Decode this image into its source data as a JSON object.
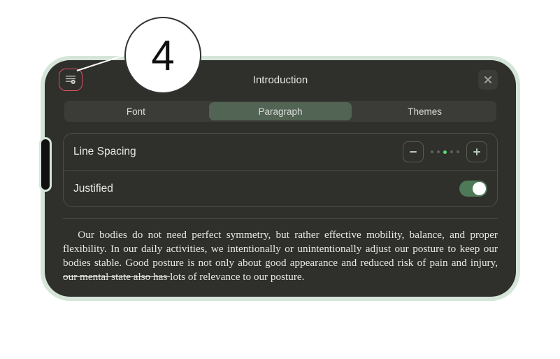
{
  "callout": {
    "number": "4"
  },
  "header": {
    "title": "Introduction"
  },
  "tabs": {
    "font": "Font",
    "paragraph": "Paragraph",
    "themes": "Themes",
    "selected": "paragraph"
  },
  "paragraph_settings": {
    "line_spacing_label": "Line Spacing",
    "line_spacing_level": 3,
    "line_spacing_max": 5,
    "justified_label": "Justified",
    "justified_on": true
  },
  "body": {
    "pre": "Our bodies do not need perfect symmetry, but rather effective mobility, balance, and proper flexibility. In our daily activities, we intentionally or unintentionally adjust our posture to keep our bodies stable. Good posture is not only about good appearance and reduced risk of pain and injury, ",
    "struck": "our mental state also has ",
    "post": "lots of relevance to our posture."
  }
}
